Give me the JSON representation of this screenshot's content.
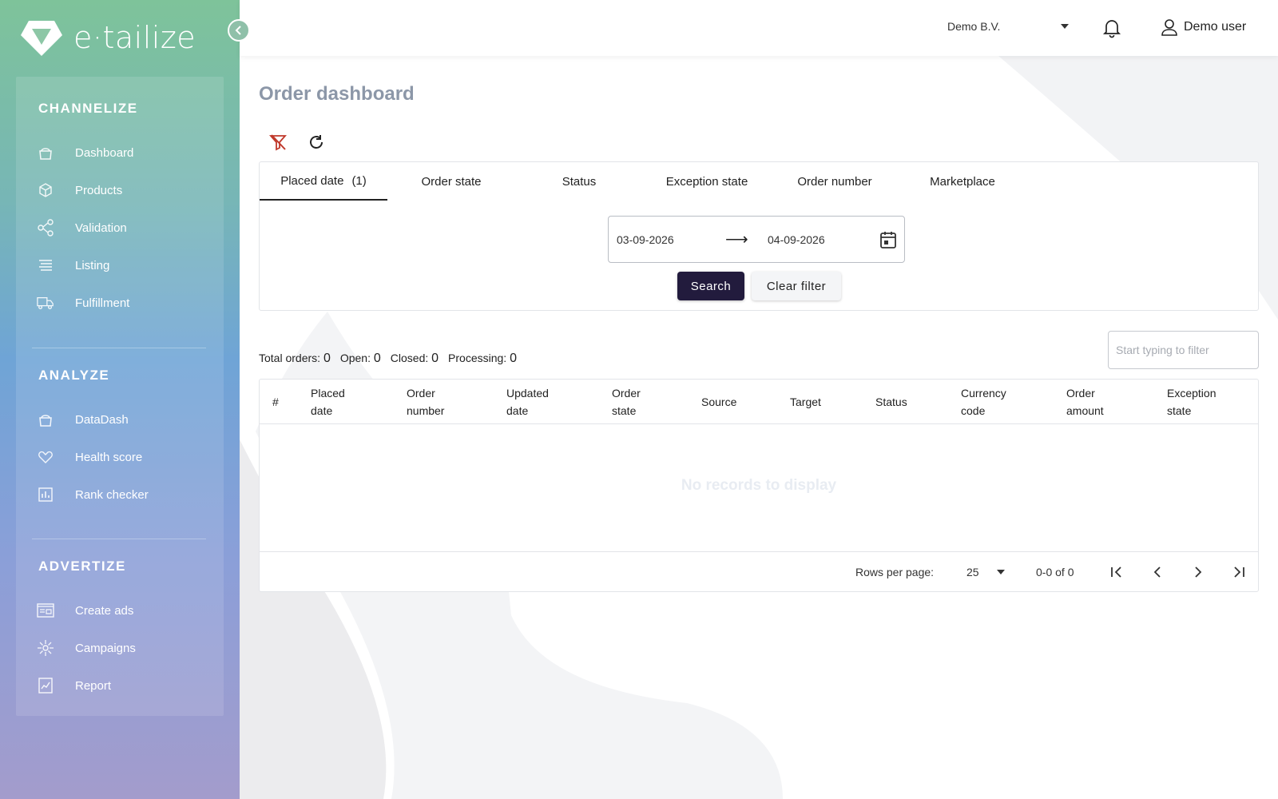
{
  "brand": {
    "logo_text": "e·tailize"
  },
  "sidebar": {
    "sections": [
      {
        "title": "CHANNELIZE",
        "items": [
          {
            "label": "Dashboard",
            "icon": "basket-icon"
          },
          {
            "label": "Products",
            "icon": "box-icon"
          },
          {
            "label": "Validation",
            "icon": "share-nodes-icon"
          },
          {
            "label": "Listing",
            "icon": "list-lines-icon"
          },
          {
            "label": "Fulfillment",
            "icon": "truck-icon"
          }
        ]
      },
      {
        "title": "ANALYZE",
        "items": [
          {
            "label": "DataDash",
            "icon": "basket-icon"
          },
          {
            "label": "Health score",
            "icon": "heart-icon"
          },
          {
            "label": "Rank checker",
            "icon": "bar-chart-icon"
          }
        ]
      },
      {
        "title": "ADVERTIZE",
        "items": [
          {
            "label": "Create ads",
            "icon": "ads-icon"
          },
          {
            "label": "Campaigns",
            "icon": "campaigns-icon"
          },
          {
            "label": "Report",
            "icon": "report-chart-icon"
          }
        ]
      }
    ]
  },
  "header": {
    "company": "Demo B.V.",
    "user": "Demo user"
  },
  "page": {
    "title": "Order dashboard"
  },
  "filters": {
    "tabs": [
      {
        "label": "Placed date",
        "count": "(1)"
      },
      {
        "label": "Order state",
        "count": ""
      },
      {
        "label": "Status",
        "count": ""
      },
      {
        "label": "Exception state",
        "count": ""
      },
      {
        "label": "Order number",
        "count": ""
      },
      {
        "label": "Marketplace",
        "count": ""
      }
    ],
    "date_from": "03-09-2026",
    "date_to": "04-09-2026",
    "arrow": "⟶",
    "search_label": "Search",
    "clear_label": "Clear filter"
  },
  "stats": {
    "total_label": "Total orders:",
    "total": "0",
    "open_label": "Open:",
    "open": "0",
    "closed_label": "Closed:",
    "closed": "0",
    "processing_label": "Processing:",
    "processing": "0"
  },
  "table_filter": {
    "placeholder": "Start typing to filter"
  },
  "table": {
    "columns": [
      "#",
      "Placed\ndate",
      "Order\nnumber",
      "Updated\ndate",
      "Order\nstate",
      "Source",
      "Target",
      "Status",
      "Currency\ncode",
      "Order\namount",
      "Exception\nstate"
    ],
    "empty_text": "No records to display",
    "rows_per_page_label": "Rows per page:",
    "rows_per_page": "25",
    "range_text": "0-0 of 0"
  },
  "colors": {
    "primary_button": "#221b3d",
    "page_title": "#8c97a8",
    "filter_icon_accent": "#c0392b"
  }
}
